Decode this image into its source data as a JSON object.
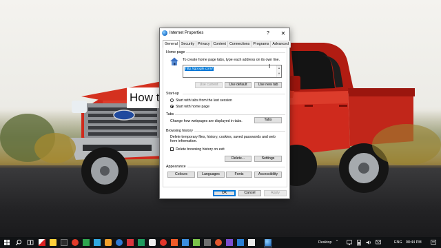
{
  "desktop": {
    "overlay_text": "How t"
  },
  "dialog": {
    "title": "Internet Properties",
    "help_glyph": "?",
    "close_glyph": "✕",
    "tabs": [
      "General",
      "Security",
      "Privacy",
      "Content",
      "Connections",
      "Programs",
      "Advanced"
    ],
    "active_tab": "General",
    "home_page": {
      "label": "Home page",
      "instruction": "To create home page tabs, type each address on its own line.",
      "url": "http://google.com/",
      "btn_use_current": "Use current",
      "btn_use_default": "Use default",
      "btn_use_new_tab": "Use new tab"
    },
    "startup": {
      "label": "Start-up",
      "option_tabs": "Start with tabs from the last session",
      "option_home": "Start with home page",
      "selected": "Start with home page"
    },
    "tabs_section": {
      "label": "Tabs",
      "description": "Change how webpages are displayed in tabs.",
      "btn_tabs": "Tabs"
    },
    "browsing_history": {
      "label": "Browsing history",
      "description_line1": "Delete temporary files, history, cookies, saved passwords and web",
      "description_line2": "form information.",
      "checkbox_label": "Delete browsing history on exit",
      "checkbox_checked": false,
      "btn_delete": "Delete...",
      "btn_settings": "Settings"
    },
    "appearance": {
      "label": "Appearance",
      "btn_colours": "Colours",
      "btn_languages": "Languages",
      "btn_fonts": "Fonts",
      "btn_accessibility": "Accessibility"
    },
    "footer": {
      "btn_ok": "OK",
      "btn_cancel": "Cancel",
      "btn_apply": "Apply"
    }
  },
  "taskbar": {
    "desktop_label": "Desktop",
    "language": "ENG",
    "time": "08:44 PM",
    "pinned_icons": [
      "start-icon",
      "search-icon",
      "task-view-icon",
      "app-icon",
      "app-icon",
      "app-icon",
      "app-icon",
      "app-icon",
      "app-icon",
      "app-icon",
      "app-icon",
      "app-icon",
      "app-icon",
      "app-icon",
      "app-icon",
      "app-icon",
      "app-icon",
      "app-icon",
      "app-icon",
      "app-icon",
      "app-icon",
      "app-icon",
      "app-icon",
      "app-icon",
      "app-icon"
    ]
  }
}
